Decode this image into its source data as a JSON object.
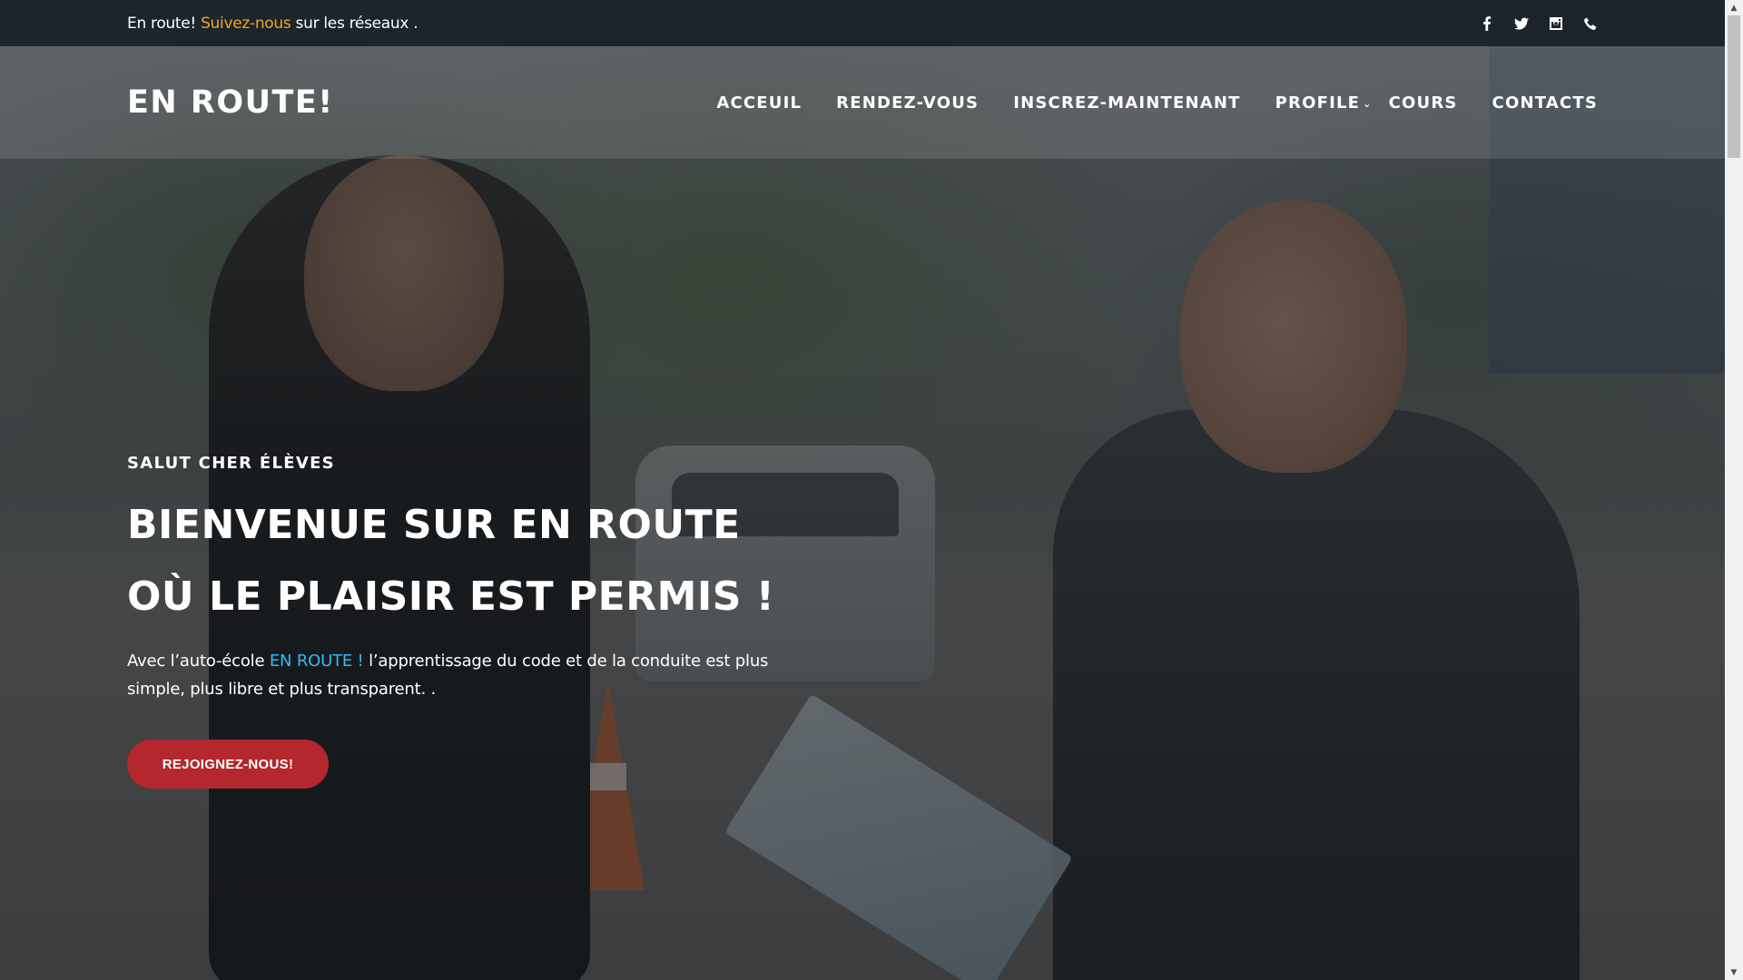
{
  "topbar": {
    "text_prefix": "En route! ",
    "text_accent": "Suivez-nous",
    "text_suffix": " sur les réseaux .",
    "icons": [
      "facebook-icon",
      "twitter-icon",
      "instagram-icon",
      "phone-icon"
    ]
  },
  "nav": {
    "brand": "EN ROUTE!",
    "items": [
      {
        "label": "ACCEUIL"
      },
      {
        "label": "RENDEZ-VOUS"
      },
      {
        "label": "INSCREZ-MAINTENANT"
      },
      {
        "label": "PROFILE",
        "has_dropdown": true
      },
      {
        "label": "COURS"
      },
      {
        "label": "CONTACTS"
      }
    ],
    "dropdown_chevron": "⌄"
  },
  "hero": {
    "eyebrow": "SALUT CHER ÉLÈVES",
    "headline_line1": "BIENVENUE SUR EN ROUTE",
    "headline_line2": "OÙ LE PLAISIR EST PERMIS !",
    "lead_prefix": "Avec l’auto-école ",
    "lead_brand": "EN ROUTE !",
    "lead_suffix": " l’apprentissage du code et de la conduite est plus simple, plus libre et plus transparent. .",
    "cta_label": "REJOIGNEZ-NOUS!"
  },
  "colors": {
    "topbar_bg": "#1c252b",
    "accent_orange": "#f4a629",
    "accent_blue": "#33b8f2",
    "cta_red": "#b3272d"
  }
}
